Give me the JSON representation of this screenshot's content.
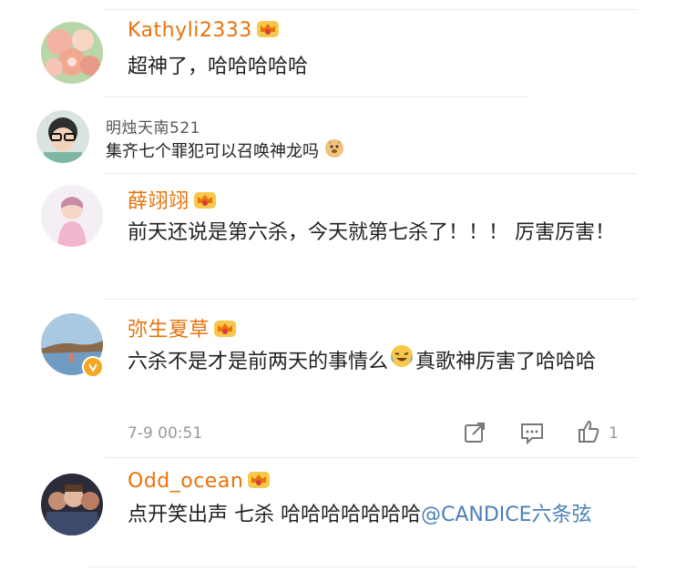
{
  "comments": [
    {
      "username": "Kathyli2333",
      "text": "超神了，哈哈哈哈哈"
    },
    {
      "username": "明烛天南521",
      "text": "集齐七个罪犯可以召唤神龙吗"
    },
    {
      "username": "薛翊翊",
      "text": "前天还说是第六杀，今天就第七杀了！！！ 厉害厉害！"
    },
    {
      "username": "弥生夏草",
      "text_part1": "六杀不是才是前两天的事情么",
      "text_part2": "真歌神厉害了哈哈哈",
      "timestamp": "7-9 00:51",
      "like_count": "1"
    },
    {
      "username": "Odd_ocean",
      "text_part1": "点开笑出声  七杀 哈哈哈哈哈哈哈",
      "mention": "@CANDICE六条弦"
    }
  ],
  "icons": {
    "crown": "crown-badge-icon",
    "verified": "verified-badge-icon",
    "share": "share-icon",
    "comment": "comment-icon",
    "like": "like-icon"
  },
  "colors": {
    "username": "#e8730c",
    "mention": "#4a7fb5",
    "meta": "#999999"
  }
}
